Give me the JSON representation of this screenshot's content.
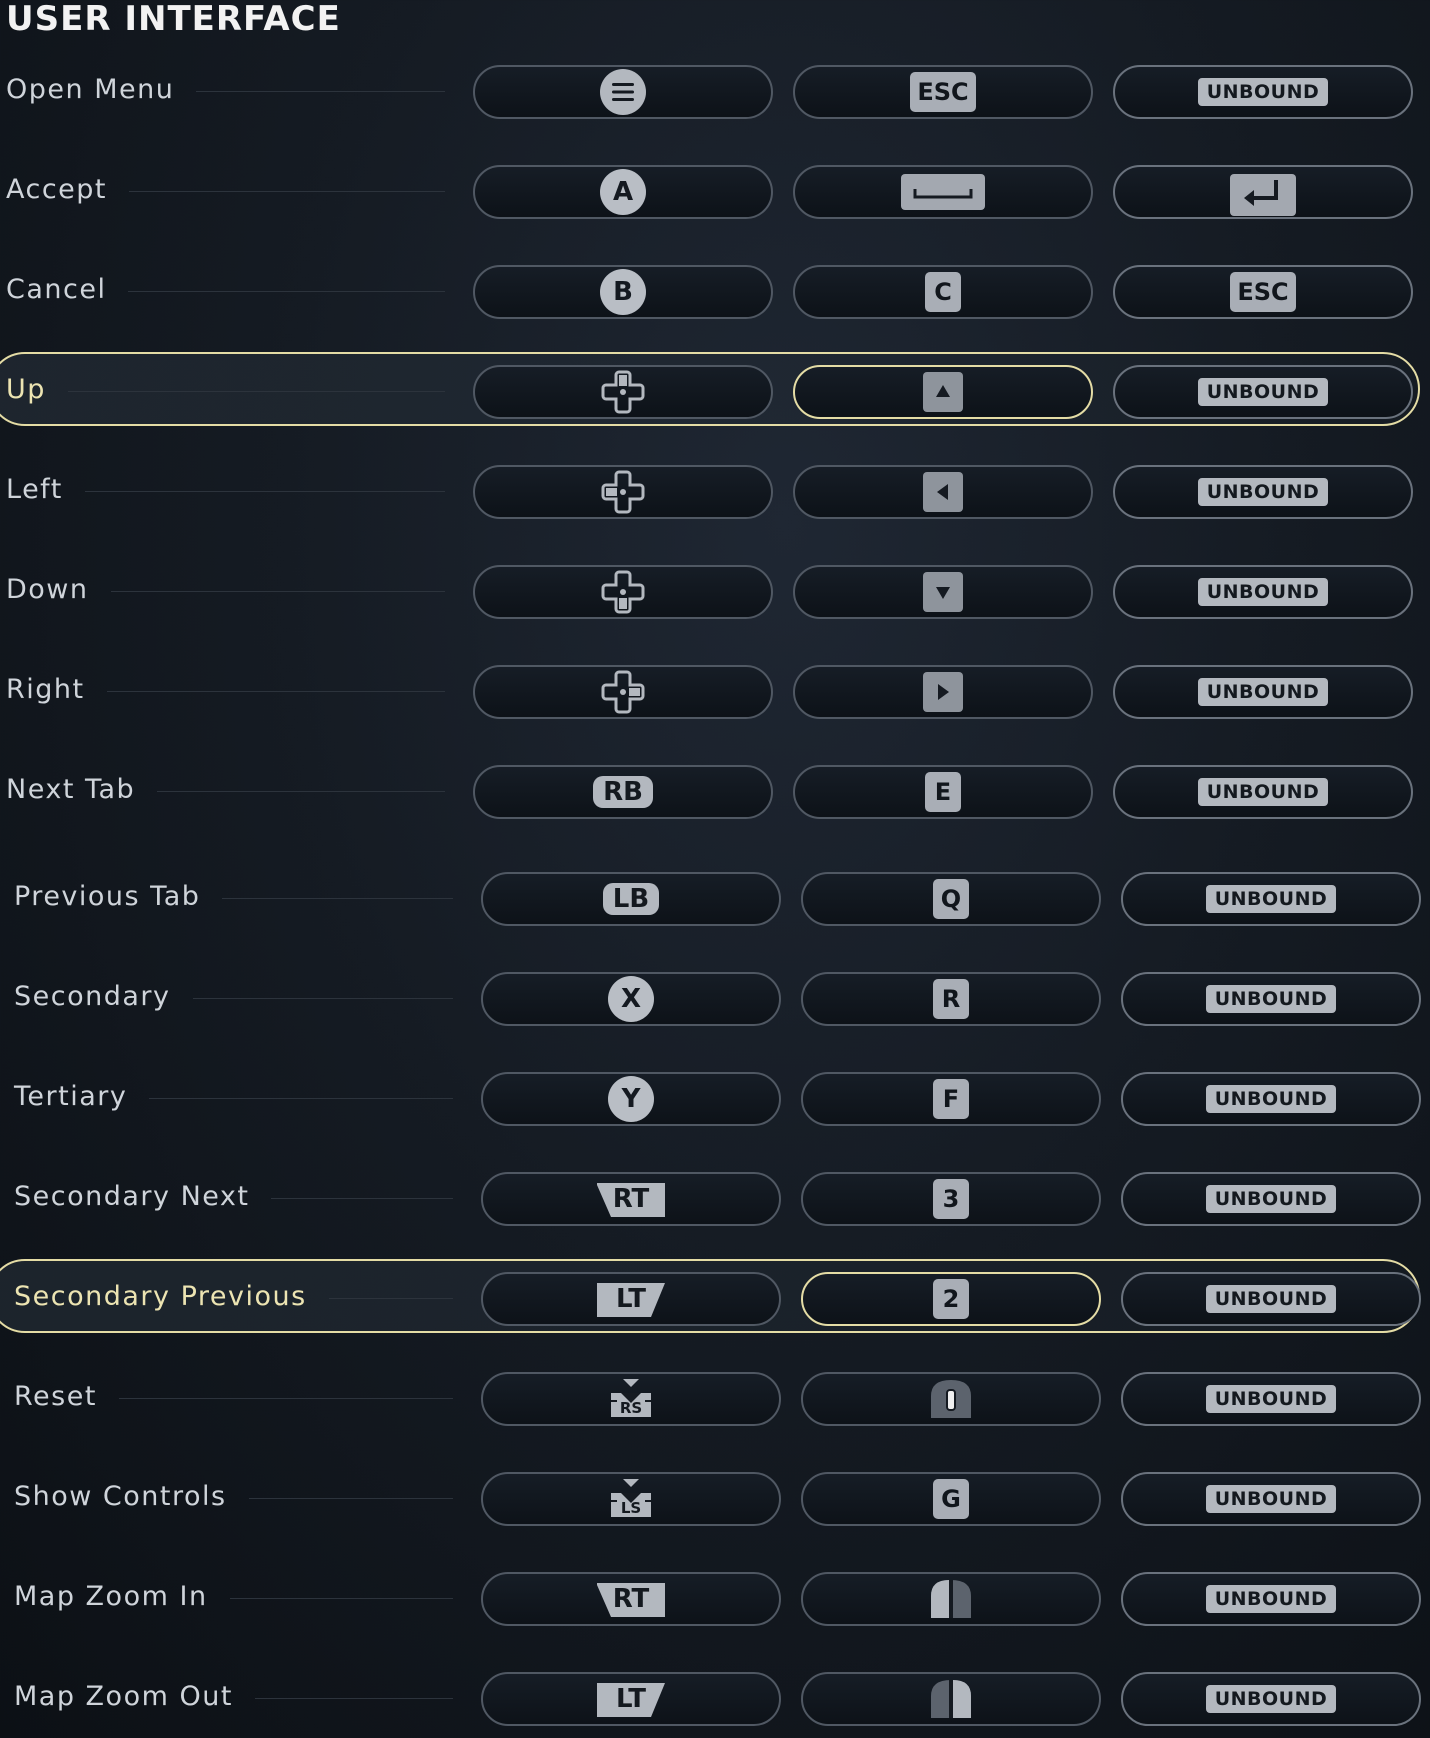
{
  "section": {
    "title": "USER INTERFACE"
  },
  "rows": [
    {
      "label": "Open Menu",
      "controller": {
        "type": "menu-icon"
      },
      "keyboard": {
        "type": "key",
        "text": "ESC"
      },
      "alt": {
        "type": "unbound",
        "text": "UNBOUND"
      }
    },
    {
      "label": "Accept",
      "controller": {
        "type": "face",
        "text": "A"
      },
      "keyboard": {
        "type": "spacebar-icon"
      },
      "alt": {
        "type": "enter-icon"
      }
    },
    {
      "label": "Cancel",
      "controller": {
        "type": "face",
        "text": "B"
      },
      "keyboard": {
        "type": "key",
        "text": "C"
      },
      "alt": {
        "type": "key",
        "text": "ESC"
      }
    },
    {
      "label": "Up",
      "controller": {
        "type": "dpad",
        "dir": "up"
      },
      "keyboard": {
        "type": "arrow-key",
        "dir": "up"
      },
      "alt": {
        "type": "unbound",
        "text": "UNBOUND"
      },
      "selected": true
    },
    {
      "label": "Left",
      "controller": {
        "type": "dpad",
        "dir": "left"
      },
      "keyboard": {
        "type": "arrow-key",
        "dir": "left"
      },
      "alt": {
        "type": "unbound",
        "text": "UNBOUND"
      }
    },
    {
      "label": "Down",
      "controller": {
        "type": "dpad",
        "dir": "down"
      },
      "keyboard": {
        "type": "arrow-key",
        "dir": "down"
      },
      "alt": {
        "type": "unbound",
        "text": "UNBOUND"
      }
    },
    {
      "label": "Right",
      "controller": {
        "type": "dpad",
        "dir": "right"
      },
      "keyboard": {
        "type": "arrow-key",
        "dir": "right"
      },
      "alt": {
        "type": "unbound",
        "text": "UNBOUND"
      }
    },
    {
      "label": "Next Tab",
      "controller": {
        "type": "bumper",
        "text": "RB"
      },
      "keyboard": {
        "type": "key",
        "text": "E"
      },
      "alt": {
        "type": "unbound",
        "text": "UNBOUND"
      }
    },
    {
      "label": "Previous Tab",
      "controller": {
        "type": "bumper",
        "text": "LB"
      },
      "keyboard": {
        "type": "key",
        "text": "Q"
      },
      "alt": {
        "type": "unbound",
        "text": "UNBOUND"
      }
    },
    {
      "label": "Secondary",
      "controller": {
        "type": "face",
        "text": "X"
      },
      "keyboard": {
        "type": "key",
        "text": "R"
      },
      "alt": {
        "type": "unbound",
        "text": "UNBOUND"
      }
    },
    {
      "label": "Tertiary",
      "controller": {
        "type": "face",
        "text": "Y"
      },
      "keyboard": {
        "type": "key",
        "text": "F"
      },
      "alt": {
        "type": "unbound",
        "text": "UNBOUND"
      }
    },
    {
      "label": "Secondary Next",
      "controller": {
        "type": "trigger",
        "text": "RT",
        "side": "right"
      },
      "keyboard": {
        "type": "key",
        "text": "3"
      },
      "alt": {
        "type": "unbound",
        "text": "UNBOUND"
      }
    },
    {
      "label": "Secondary Previous",
      "controller": {
        "type": "trigger",
        "text": "LT",
        "side": "left"
      },
      "keyboard": {
        "type": "key",
        "text": "2"
      },
      "alt": {
        "type": "unbound",
        "text": "UNBOUND"
      },
      "selected": true
    },
    {
      "label": "Reset",
      "controller": {
        "type": "stick",
        "text": "RS"
      },
      "keyboard": {
        "type": "mouse",
        "part": "middle"
      },
      "alt": {
        "type": "unbound",
        "text": "UNBOUND"
      }
    },
    {
      "label": "Show Controls",
      "controller": {
        "type": "stick",
        "text": "LS"
      },
      "keyboard": {
        "type": "key",
        "text": "G"
      },
      "alt": {
        "type": "unbound",
        "text": "UNBOUND"
      }
    },
    {
      "label": "Map Zoom In",
      "controller": {
        "type": "trigger",
        "text": "RT",
        "side": "right"
      },
      "keyboard": {
        "type": "mouse",
        "part": "left"
      },
      "alt": {
        "type": "unbound",
        "text": "UNBOUND"
      }
    },
    {
      "label": "Map Zoom Out",
      "controller": {
        "type": "trigger",
        "text": "LT",
        "side": "left"
      },
      "keyboard": {
        "type": "mouse",
        "part": "right"
      },
      "alt": {
        "type": "unbound",
        "text": "UNBOUND"
      }
    }
  ],
  "colors": {
    "highlight": "#e4dca5",
    "glyph": "#b3b8bf",
    "text": "#cfd4da"
  }
}
